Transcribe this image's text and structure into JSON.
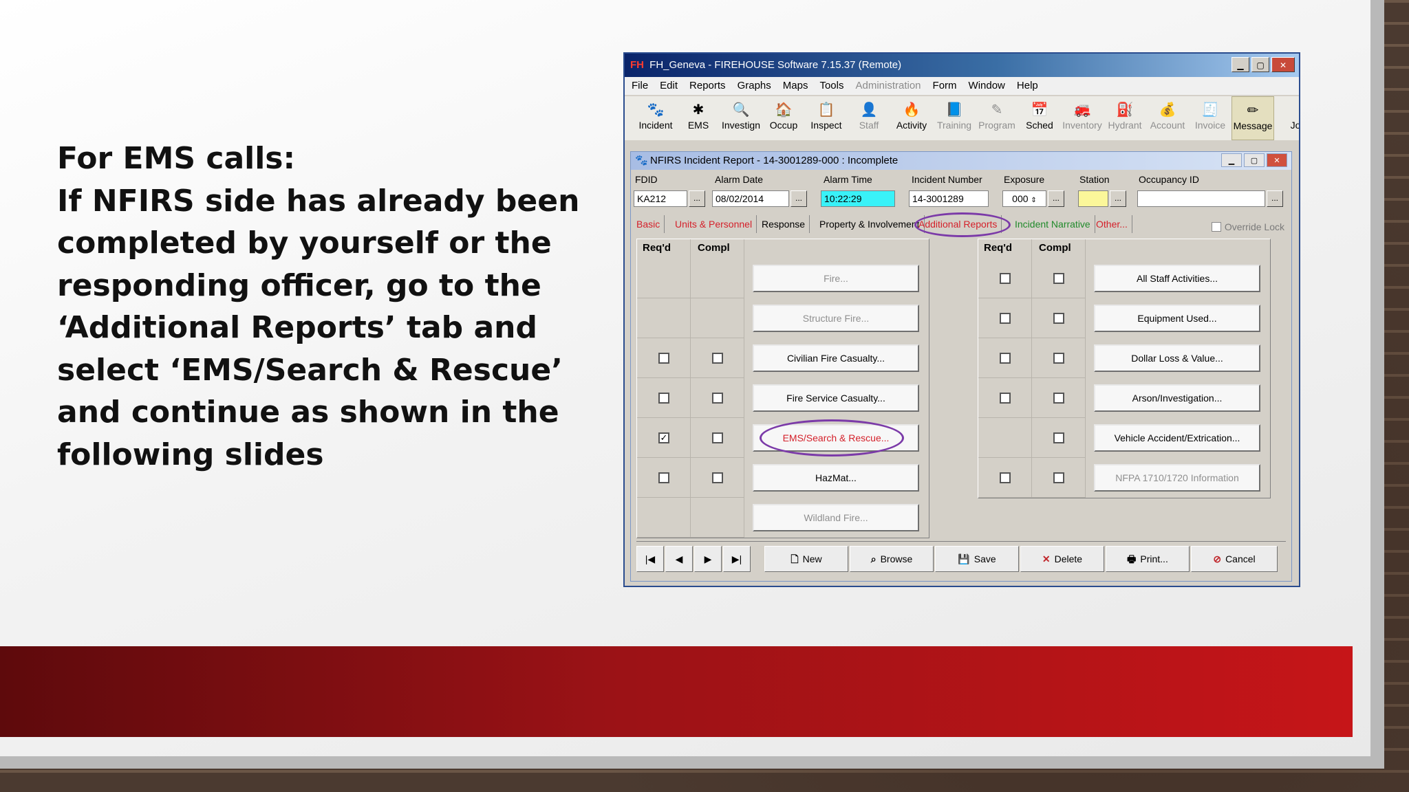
{
  "slide": {
    "body_lines": [
      "For EMS calls:",
      "If NFIRS side has already been",
      "completed by yourself or the",
      "responding officer, go to the",
      "‘Additional Reports’ tab and",
      "select ‘EMS/Search & Rescue’",
      "and continue as shown in the",
      "following slides"
    ],
    "accent_color": "#c61518"
  },
  "app": {
    "logo": "FH",
    "title": "FH_Geneva - FIREHOUSE Software 7.15.37 (Remote)",
    "menu": [
      "File",
      "Edit",
      "Reports",
      "Graphs",
      "Maps",
      "Tools",
      "Administration",
      "Form",
      "Window",
      "Help"
    ],
    "toolbar": [
      {
        "label": "Incident",
        "icon": "paw-icon",
        "glyph": "🐾",
        "disabled": false
      },
      {
        "label": "EMS",
        "icon": "star-of-life-icon",
        "glyph": "✱",
        "disabled": false
      },
      {
        "label": "Investign",
        "icon": "magnifier-icon",
        "glyph": "🔍",
        "disabled": false
      },
      {
        "label": "Occup",
        "icon": "building-icon",
        "glyph": "🏠",
        "disabled": false
      },
      {
        "label": "Inspect",
        "icon": "clipboard-icon",
        "glyph": "📋",
        "disabled": false
      },
      {
        "label": "Staff",
        "icon": "person-icon",
        "glyph": "👤",
        "disabled": true
      },
      {
        "label": "Activity",
        "icon": "activity-icon",
        "glyph": "🔥",
        "disabled": false
      },
      {
        "label": "Training",
        "icon": "book-icon",
        "glyph": "📘",
        "disabled": true
      },
      {
        "label": "Program",
        "icon": "program-icon",
        "glyph": "✎",
        "disabled": true
      },
      {
        "label": "Sched",
        "icon": "calendar-icon",
        "glyph": "📅",
        "disabled": false
      },
      {
        "label": "Inventory",
        "icon": "truck-icon",
        "glyph": "🚒",
        "disabled": true
      },
      {
        "label": "Hydrant",
        "icon": "hydrant-icon",
        "glyph": "⛽",
        "disabled": true
      },
      {
        "label": "Account",
        "icon": "coins-icon",
        "glyph": "💰",
        "disabled": true
      },
      {
        "label": "Invoice",
        "icon": "invoice-icon",
        "glyph": "🧾",
        "disabled": true
      },
      {
        "label": "Message",
        "icon": "pencil-icon",
        "glyph": "✏",
        "disabled": false
      },
      {
        "label": "Jo",
        "icon": "journal-icon",
        "glyph": "",
        "disabled": false
      }
    ],
    "report": {
      "title": "NFIRS Incident Report  - 14-3001289-000   : Incomplete",
      "fields": {
        "fdid": {
          "label": "FDID",
          "value": "KA212"
        },
        "alarm_date": {
          "label": "Alarm Date",
          "value": "08/02/2014"
        },
        "alarm_time": {
          "label": "Alarm Time",
          "value": "10:22:29"
        },
        "incident_number": {
          "label": "Incident Number",
          "value": "14-3001289"
        },
        "exposure": {
          "label": "Exposure",
          "value": "000"
        },
        "station": {
          "label": "Station",
          "value": ""
        },
        "occupancy_id": {
          "label": "Occupancy ID",
          "value": ""
        }
      },
      "tabs": [
        {
          "label": "Basic",
          "color": "red"
        },
        {
          "label": "Units & Personnel",
          "color": "red"
        },
        {
          "label": "Response",
          "color": "black"
        },
        {
          "label": "Property & Involvement",
          "color": "black"
        },
        {
          "label": "Additional Reports",
          "color": "red"
        },
        {
          "label": "Incident Narrative",
          "color": "green"
        },
        {
          "label": "Other...",
          "color": "red"
        }
      ],
      "override_lock": "Override Lock",
      "col_reqd": "Req'd",
      "col_compl": "Compl",
      "left_reports": [
        {
          "label": "Fire...",
          "disabled": true,
          "reqd": null,
          "compl": null
        },
        {
          "label": "Structure Fire...",
          "disabled": true,
          "reqd": null,
          "compl": null
        },
        {
          "label": "Civilian Fire Casualty...",
          "disabled": false,
          "reqd": false,
          "compl": false
        },
        {
          "label": "Fire Service Casualty...",
          "disabled": false,
          "reqd": false,
          "compl": false
        },
        {
          "label": "EMS/Search & Rescue...",
          "disabled": false,
          "reqd": true,
          "compl": false,
          "highlight": true
        },
        {
          "label": "HazMat...",
          "disabled": false,
          "reqd": false,
          "compl": false
        },
        {
          "label": "Wildland Fire...",
          "disabled": true,
          "reqd": null,
          "compl": null
        }
      ],
      "right_reports": [
        {
          "label": "All Staff Activities...",
          "disabled": false,
          "reqd": false,
          "compl": false
        },
        {
          "label": "Equipment Used...",
          "disabled": false,
          "reqd": false,
          "compl": false
        },
        {
          "label": "Dollar Loss & Value...",
          "disabled": false,
          "reqd": false,
          "compl": false
        },
        {
          "label": "Arson/Investigation...",
          "disabled": false,
          "reqd": false,
          "compl": false
        },
        {
          "label": "Vehicle Accident/Extrication...",
          "disabled": false,
          "reqd": null,
          "compl": false
        },
        {
          "label": "NFPA 1710/1720 Information",
          "disabled": true,
          "reqd": false,
          "compl": false
        }
      ],
      "nav": {
        "first": "|◀",
        "prev": "◀",
        "next": "▶",
        "last": "▶|"
      },
      "actions": {
        "new": "New",
        "browse": "Browse",
        "save": "Save",
        "delete": "Delete",
        "print": "Print...",
        "cancel": "Cancel"
      }
    }
  }
}
